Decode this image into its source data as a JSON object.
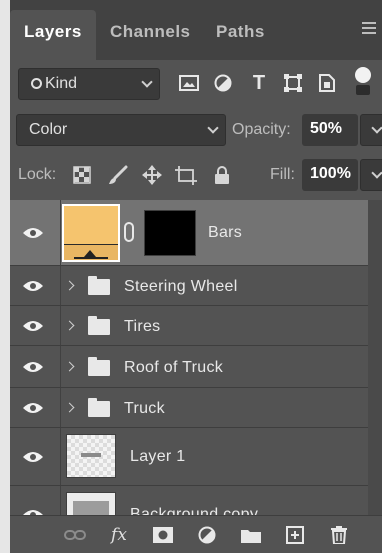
{
  "tabs": [
    {
      "label": "Layers",
      "active": true
    },
    {
      "label": "Channels",
      "active": false
    },
    {
      "label": "Paths",
      "active": false
    }
  ],
  "filter": {
    "kind_label": "Kind",
    "icons": [
      "image-filter-icon",
      "adjustment-filter-icon",
      "type-filter-icon",
      "shape-filter-icon",
      "smart-object-filter-icon",
      "filter-toggle-icon"
    ]
  },
  "blend": {
    "mode": "Color",
    "opacity_label": "Opacity:",
    "opacity_value": "50%"
  },
  "lock": {
    "label": "Lock:",
    "fill_label": "Fill:",
    "fill_value": "100%"
  },
  "layers": [
    {
      "name": "Bars",
      "type": "adjustment",
      "selected": true
    },
    {
      "name": "Steering Wheel",
      "type": "group"
    },
    {
      "name": "Tires",
      "type": "group"
    },
    {
      "name": "Roof of Truck",
      "type": "group"
    },
    {
      "name": "Truck",
      "type": "group"
    },
    {
      "name": "Layer 1",
      "type": "pixel"
    },
    {
      "name": "Background copy",
      "type": "pixel"
    }
  ],
  "bottom_icons": [
    "link-layers-icon",
    "fx-icon",
    "add-mask-icon",
    "new-adjustment-icon",
    "new-group-icon",
    "new-layer-icon",
    "trash-icon"
  ],
  "colors": {
    "panel": "#535353",
    "selected_row": "#737373",
    "swatch": "#f5c46e"
  },
  "bottom": {
    "fx": "fx"
  },
  "filter_glyphs": {
    "type": "T"
  }
}
